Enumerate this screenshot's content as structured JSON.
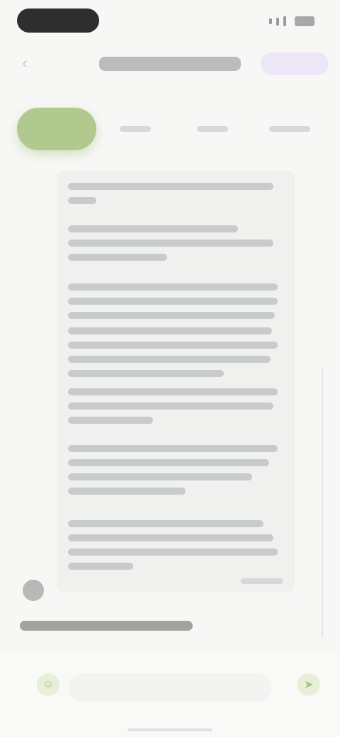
{
  "header": {
    "title": "",
    "back_icon": "chevron-left-icon",
    "action_label": ""
  },
  "tabs": [
    {
      "label": "",
      "active": true
    },
    {
      "label": "",
      "active": false
    },
    {
      "label": "",
      "active": false
    },
    {
      "label": "",
      "active": false
    }
  ],
  "article": {
    "text": ""
  },
  "comment": {
    "author_label": ""
  },
  "bottom_bar": {
    "input_placeholder": "",
    "left_icon": "emoji-icon",
    "right_icon": "send-icon"
  },
  "colors": {
    "accent": "#b1c98e",
    "header_action_bg": "#ece6f7",
    "background": "#f7f7f6"
  }
}
